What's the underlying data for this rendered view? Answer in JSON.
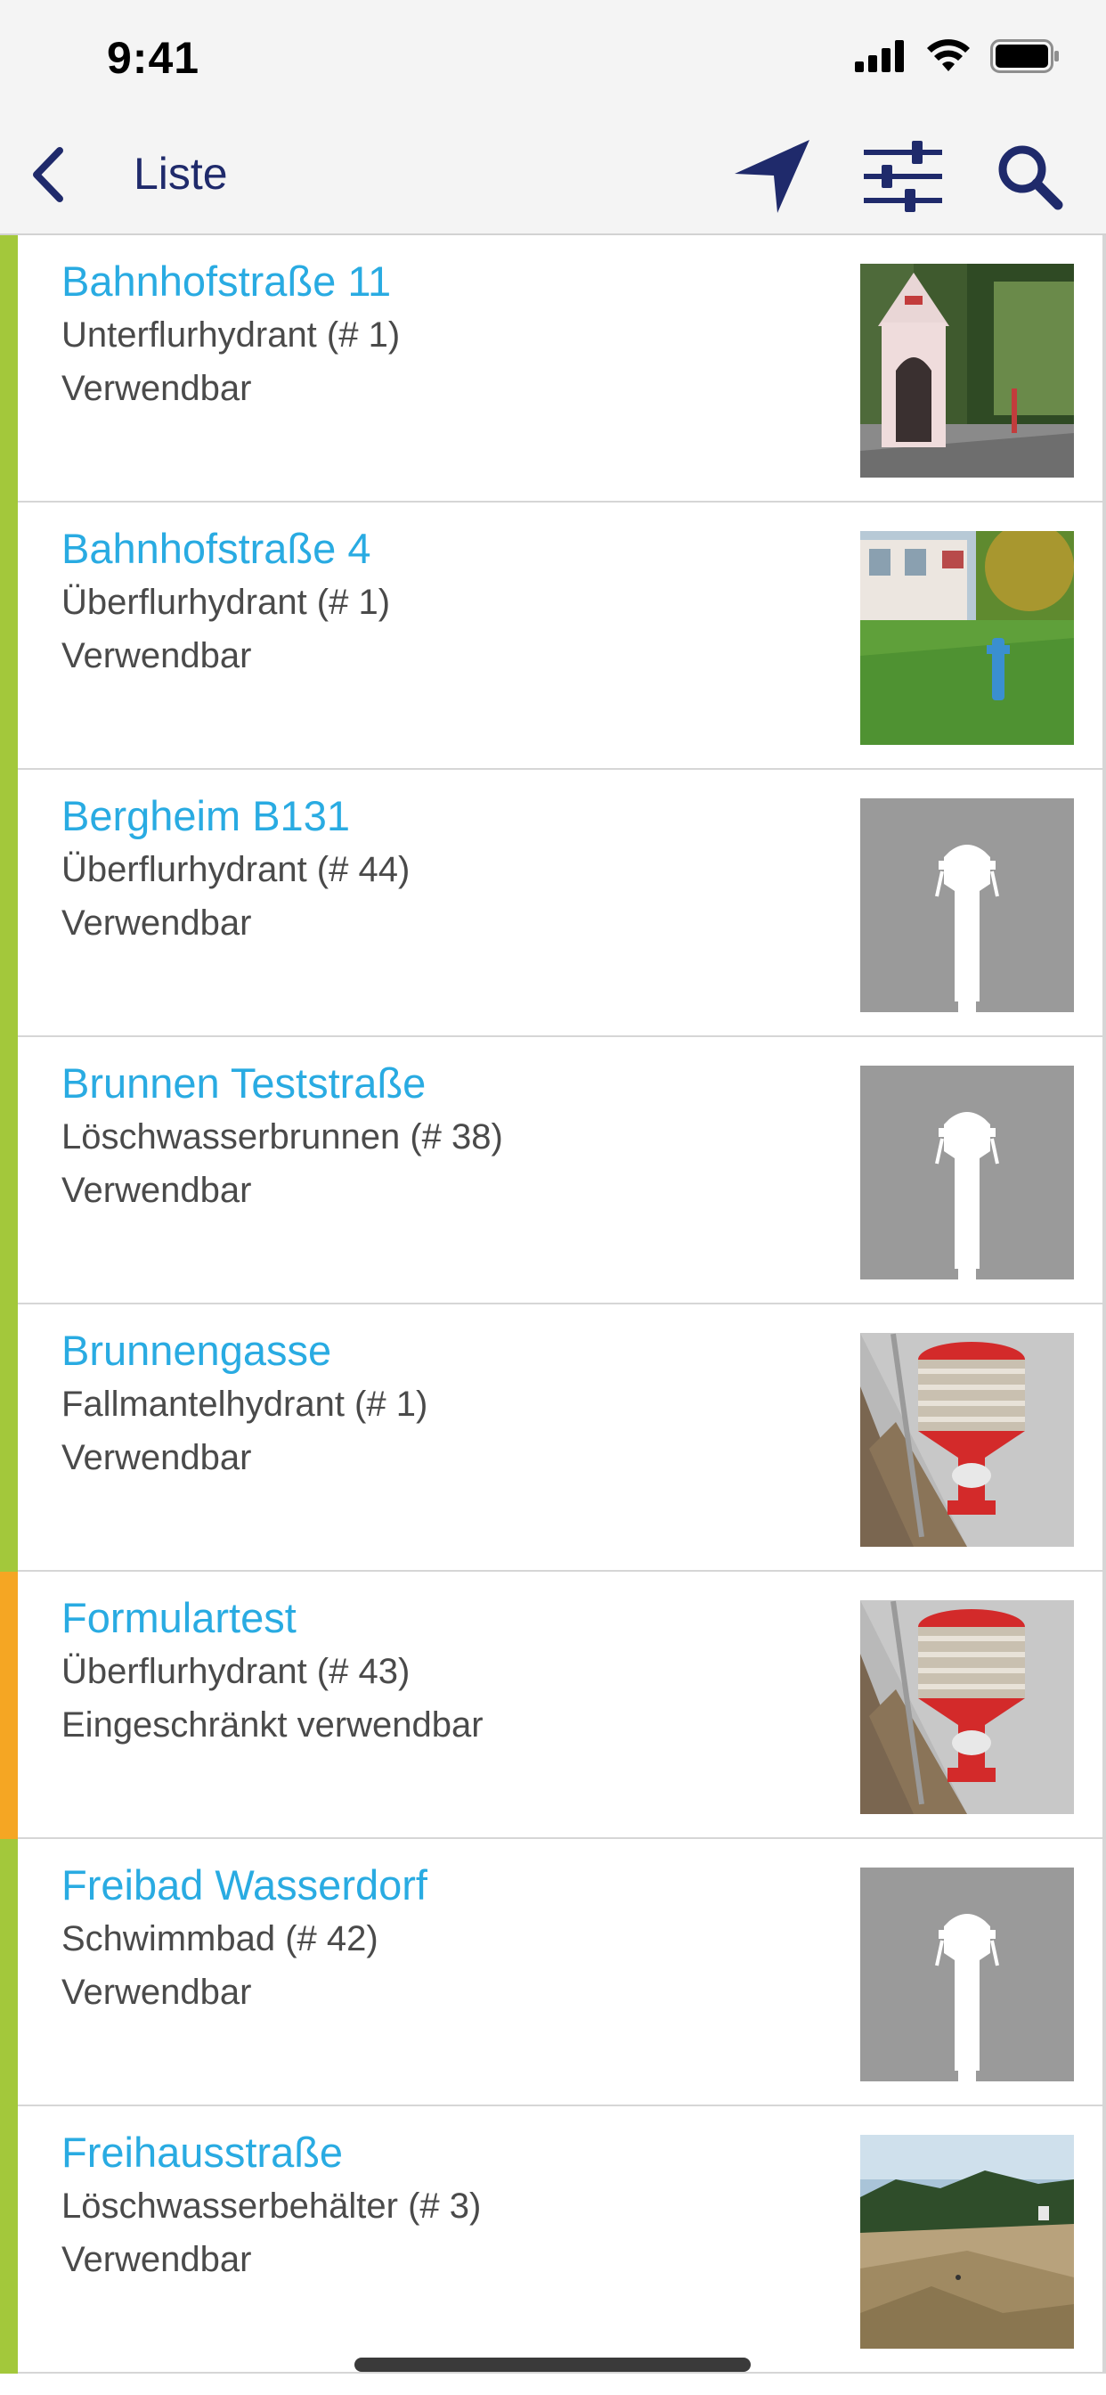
{
  "status_bar": {
    "time": "9:41"
  },
  "nav": {
    "title": "Liste",
    "back_icon": "chevron-left-icon",
    "actions": [
      "location-arrow-icon",
      "sliders-icon",
      "search-icon"
    ],
    "accent_color": "#1f2a6b"
  },
  "colors": {
    "title": "#29abe2",
    "usable": "#a3c83b",
    "restricted": "#f5a623"
  },
  "items": [
    {
      "title": "Bahnhofstraße 11",
      "type": "Unterflurhydrant (# 1)",
      "status": "Verwendbar",
      "status_color": "#a3c83b",
      "image": "chapel-photo"
    },
    {
      "title": "Bahnhofstraße 4",
      "type": "Überflurhydrant (# 1)",
      "status": "Verwendbar",
      "status_color": "#a3c83b",
      "image": "lawn-hydrant-photo"
    },
    {
      "title": "Bergheim B131",
      "type": "Überflurhydrant (# 44)",
      "status": "Verwendbar",
      "status_color": "#a3c83b",
      "image": "hydrant-placeholder"
    },
    {
      "title": "Brunnen Teststraße",
      "type": "Löschwasserbrunnen (# 38)",
      "status": "Verwendbar",
      "status_color": "#a3c83b",
      "image": "hydrant-placeholder"
    },
    {
      "title": "Brunnengasse",
      "type": "Fallmantelhydrant (# 1)",
      "status": "Verwendbar",
      "status_color": "#a3c83b",
      "image": "red-hydrant-photo"
    },
    {
      "title": "Formulartest",
      "type": "Überflurhydrant (# 43)",
      "status": "Eingeschränkt verwendbar",
      "status_color": "#f5a623",
      "image": "red-hydrant-photo"
    },
    {
      "title": "Freibad Wasserdorf",
      "type": "Schwimmbad (# 42)",
      "status": "Verwendbar",
      "status_color": "#a3c83b",
      "image": "hydrant-placeholder"
    },
    {
      "title": "Freihausstraße",
      "type": "Löschwasserbehälter (# 3)",
      "status": "Verwendbar",
      "status_color": "#a3c83b",
      "image": "construction-site-photo"
    }
  ]
}
